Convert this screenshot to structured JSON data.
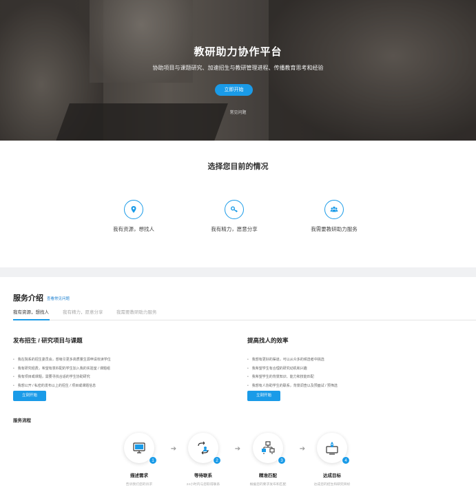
{
  "hero": {
    "title": "教研助力协作平台",
    "subtitle": "协助项目与课题研究、加速招生与教研管理进程、传播教育思考和经验",
    "cta": "立即开始",
    "faq": "常见问题"
  },
  "choose": {
    "title": "选择您目前的情况",
    "options": [
      {
        "label": "我有资源，想找人",
        "icon": "location-pin-icon"
      },
      {
        "label": "我有精力，愿意分享",
        "icon": "key-icon"
      },
      {
        "label": "我需要教研助力服务",
        "icon": "people-group-icon"
      }
    ]
  },
  "service": {
    "title": "服务介绍",
    "faq_link": "查看常见问题",
    "tabs": [
      "我有资源，想找人",
      "我有精力，愿意分享",
      "我需要教研助力服务"
    ],
    "active_tab": 0,
    "left": {
      "title": "发布招生 / 研究项目与课题",
      "items": [
        "我在院系的招生委员会，想吸引更多高质量生源申请攻读学位",
        "我有研究经费，希望有意匹配的学生加入我的实验室 / 课题组",
        "我有项目或课题，需要寻找合适的学生协助研究",
        "我想公开 / 私密的发布以上的招生 / 项目或课题信息"
      ],
      "button": "立刻开始"
    },
    "right": {
      "title": "提高找人的效率",
      "items": [
        "我想有更好的渠道，可以从众多的候选者中挑选",
        "我希望学生有合理的研究动机和兴趣",
        "我希望学生的背景知识、能力和技能匹配",
        "我想有人协助学生的联系，背景调查以及预面试 / 预筛选"
      ],
      "button": "立刻开始"
    },
    "flow_title": "服务流程",
    "steps": [
      {
        "num": "1",
        "title": "描述需求",
        "desc": "告诉我们您的诉求"
      },
      {
        "num": "2",
        "title": "等待联系",
        "desc": "24小时内与您取得联系"
      },
      {
        "num": "3",
        "title": "精准匹配",
        "desc": "根据您的要求发布和匹配"
      },
      {
        "num": "4",
        "title": "达成目标",
        "desc": "达成您的招生和研究目标"
      }
    ],
    "accent": "#1a9be8"
  }
}
